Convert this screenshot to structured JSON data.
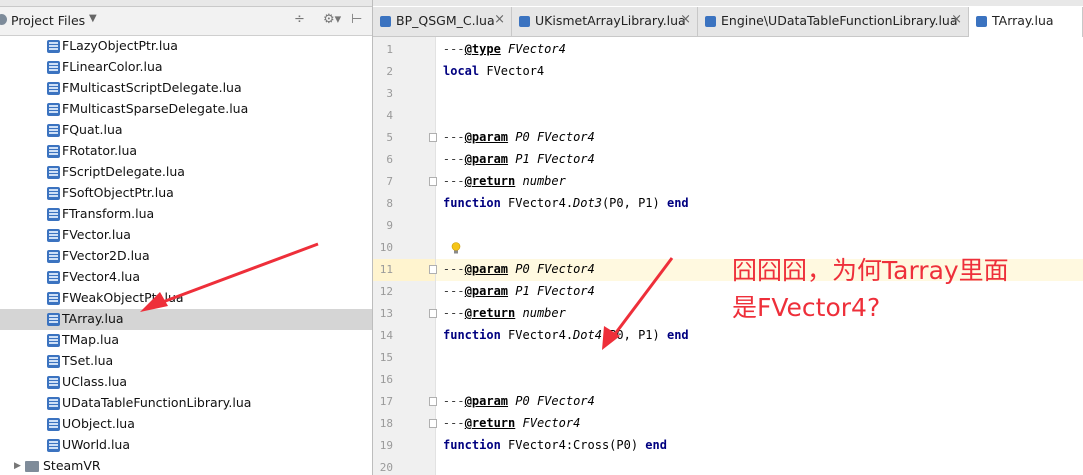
{
  "project_panel": {
    "title": "Project Files",
    "files": [
      "FLazyObjectPtr.lua",
      "FLinearColor.lua",
      "FMulticastScriptDelegate.lua",
      "FMulticastSparseDelegate.lua",
      "FQuat.lua",
      "FRotator.lua",
      "FScriptDelegate.lua",
      "FSoftObjectPtr.lua",
      "FTransform.lua",
      "FVector.lua",
      "FVector2D.lua",
      "FVector4.lua",
      "FWeakObjectPtr.lua",
      "TArray.lua",
      "TMap.lua",
      "TSet.lua",
      "UClass.lua",
      "UDataTableFunctionLibrary.lua",
      "UObject.lua",
      "UWorld.lua"
    ],
    "selected": "TArray.lua",
    "folder": "SteamVR"
  },
  "tabs": [
    {
      "label": "BP_QSGM_C.lua"
    },
    {
      "label": "UKismetArrayLibrary.lua"
    },
    {
      "label": "Engine\\UDataTableFunctionLibrary.lua"
    },
    {
      "label": "TArray.lua",
      "active": true
    }
  ],
  "line_numbers": [
    "1",
    "2",
    "3",
    "4",
    "5",
    "6",
    "7",
    "8",
    "9",
    "10",
    "11",
    "12",
    "13",
    "14",
    "15",
    "16",
    "17",
    "18",
    "19",
    "20"
  ],
  "code": {
    "l1": {
      "prefix": "---",
      "tag": "@type",
      "type": " FVector4"
    },
    "l2": {
      "kw": "local",
      "rest": " FVector4"
    },
    "l5": {
      "prefix": "---",
      "tag": "@param",
      "name": " P0",
      "type": " FVector4"
    },
    "l6": {
      "prefix": "---",
      "tag": "@param",
      "name": " P1",
      "type": " FVector4"
    },
    "l7": {
      "prefix": "---",
      "tag": "@return",
      "type": " number"
    },
    "l8": {
      "kw": "function",
      "obj": " FVector4.",
      "fn": "Dot3",
      "args": "(P0, P1) ",
      "end": "end"
    },
    "l11": {
      "prefix": "---",
      "tag": "@param",
      "name": " P0",
      "type": " FVector4"
    },
    "l12": {
      "prefix": "---",
      "tag": "@param",
      "name": " P1",
      "type": " FVector4"
    },
    "l13": {
      "prefix": "---",
      "tag": "@return",
      "type": " number"
    },
    "l14": {
      "kw": "function",
      "obj": " FVector4.",
      "fn": "Dot4",
      "args": "(P0, P1) ",
      "end": "end"
    },
    "l17": {
      "prefix": "---",
      "tag": "@param",
      "name": " P0",
      "type": " FVector4"
    },
    "l18": {
      "prefix": "---",
      "tag": "@return",
      "type": " FVector4"
    },
    "l19": {
      "kw": "function",
      "obj": " FVector4:Cross(P0) ",
      "end": "end"
    }
  },
  "annotation": {
    "line1": "囧囧囧，为何Tarray里面",
    "line2": "是FVector4?",
    "color": "#ee2f3a"
  },
  "colors": {
    "keyword": "#000080",
    "selected_row": "#d5d5d5",
    "current_line": "#fff9e0"
  }
}
